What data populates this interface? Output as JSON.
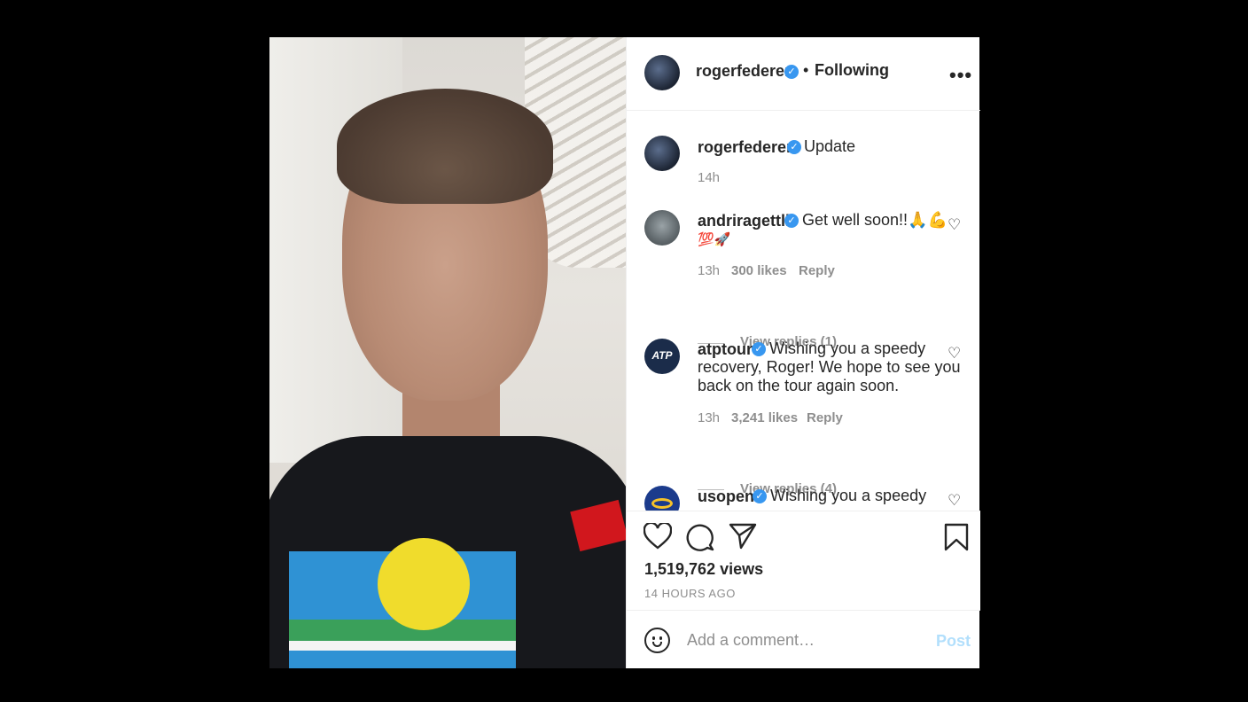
{
  "header": {
    "username": "rogerfederer",
    "separator": "•",
    "follow_status": "Following",
    "more_icon": "more-horizontal-icon"
  },
  "caption": {
    "username": "rogerfederer",
    "text": "Update",
    "time": "14h"
  },
  "comments": [
    {
      "username": "andriragettli",
      "text_line1": "Get well soon!!🙏💪",
      "text_line2": "💯🚀",
      "time": "13h",
      "likes": "300 likes",
      "reply": "Reply",
      "view_replies": "View replies (1)"
    },
    {
      "username": "atptour",
      "text_line1": "Wishing you a speedy",
      "text_line2": "recovery, Roger! We hope to see you",
      "text_line3": "back on the tour again soon.",
      "time": "13h",
      "likes": "3,241 likes",
      "reply": "Reply",
      "view_replies": "View replies (4)",
      "avatar_text": "ATP"
    },
    {
      "username": "usopen",
      "text_line1": "Wishing you a speedy"
    }
  ],
  "actions": {
    "icons": [
      "heart-icon",
      "comment-icon",
      "share-icon",
      "bookmark-icon"
    ],
    "views": "1,519,762 views",
    "posted_ago": "14 HOURS AGO"
  },
  "composer": {
    "placeholder": "Add a comment…",
    "post_label": "Post"
  },
  "colors": {
    "verified": "#3897f0",
    "post_disabled": "#b2dffc",
    "muted": "#8e8e8e"
  }
}
